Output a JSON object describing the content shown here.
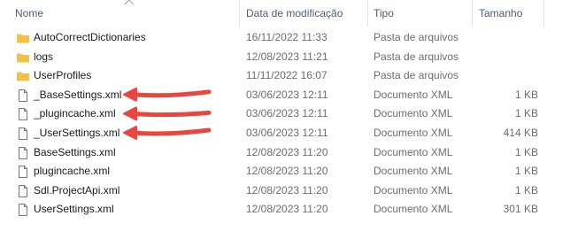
{
  "columns": {
    "name": "Nome",
    "date": "Data de modificação",
    "type": "Tipo",
    "size": "Tamanho"
  },
  "files": [
    {
      "name": "AutoCorrectDictionaries",
      "date": "16/11/2022 11:33",
      "type": "Pasta de arquivos",
      "size": "",
      "icon": "folder-icon"
    },
    {
      "name": "logs",
      "date": "12/08/2023 11:21",
      "type": "Pasta de arquivos",
      "size": "",
      "icon": "folder-icon"
    },
    {
      "name": "UserProfiles",
      "date": "11/11/2022 16:07",
      "type": "Pasta de arquivos",
      "size": "",
      "icon": "folder-icon"
    },
    {
      "name": "_BaseSettings.xml",
      "date": "03/06/2023 12:11",
      "type": "Documento XML",
      "size": "1 KB",
      "icon": "file-icon"
    },
    {
      "name": "_plugincache.xml",
      "date": "03/06/2023 12:11",
      "type": "Documento XML",
      "size": "1 KB",
      "icon": "file-icon"
    },
    {
      "name": "_UserSettings.xml",
      "date": "03/06/2023 12:11",
      "type": "Documento XML",
      "size": "414 KB",
      "icon": "file-icon"
    },
    {
      "name": "BaseSettings.xml",
      "date": "12/08/2023 11:20",
      "type": "Documento XML",
      "size": "1 KB",
      "icon": "file-icon"
    },
    {
      "name": "plugincache.xml",
      "date": "12/08/2023 11:20",
      "type": "Documento XML",
      "size": "1 KB",
      "icon": "file-icon"
    },
    {
      "name": "Sdl.ProjectApi.xml",
      "date": "12/08/2023 11:20",
      "type": "Documento XML",
      "size": "1 KB",
      "icon": "file-icon"
    },
    {
      "name": "UserSettings.xml",
      "date": "12/08/2023 11:20",
      "type": "Documento XML",
      "size": "301 KB",
      "icon": "file-icon"
    }
  ],
  "annotations": {
    "arrow_color": "#e8473f",
    "highlighted_rows": [
      3,
      4,
      5
    ]
  },
  "colors": {
    "folder": "#f0c24b",
    "header_text": "#4c607a",
    "secondary_text": "#6d6d6d"
  }
}
